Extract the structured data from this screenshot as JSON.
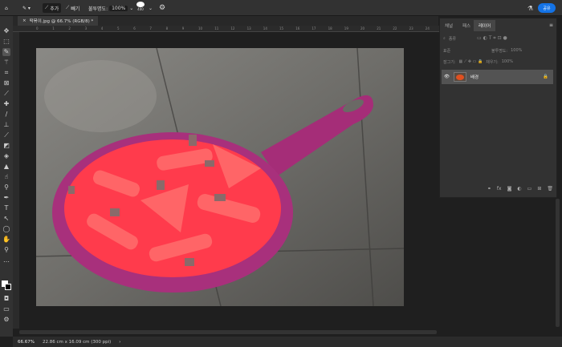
{
  "options_bar": {
    "add_label": "추가",
    "subtract_label": "빼기",
    "opacity_label": "불투명도:",
    "opacity_value": "100%",
    "brush_size": "400",
    "share_label": "공유"
  },
  "document_tab": {
    "title": "떡볶이.jpg @ 66.7% (RGB/8) *"
  },
  "ruler": {
    "labels": [
      "0",
      "1",
      "2",
      "3",
      "4",
      "5",
      "6",
      "7",
      "8",
      "9",
      "10",
      "11",
      "12",
      "13",
      "14",
      "15",
      "16",
      "17",
      "18",
      "19",
      "20",
      "21",
      "22",
      "23",
      "24"
    ]
  },
  "layers_panel": {
    "tabs": [
      "채널",
      "패스",
      "레이어"
    ],
    "active_tab": "레이어",
    "filter_placeholder": "종류",
    "blend_mode": "표준",
    "opacity_label": "불투명도:",
    "opacity_value": "100%",
    "lock_label": "잠그기:",
    "fill_label": "채우기:",
    "fill_value": "100%",
    "layers": [
      {
        "name": "배경",
        "visible": true,
        "locked": true
      }
    ]
  },
  "status_bar": {
    "zoom": "66.67%",
    "doc_info": "22.86 cm x 16.09 cm (300 ppi)"
  },
  "colors": {
    "accent": "#1473e6",
    "mask_overlay": "#c0287a",
    "food": "#ff3a4a"
  }
}
